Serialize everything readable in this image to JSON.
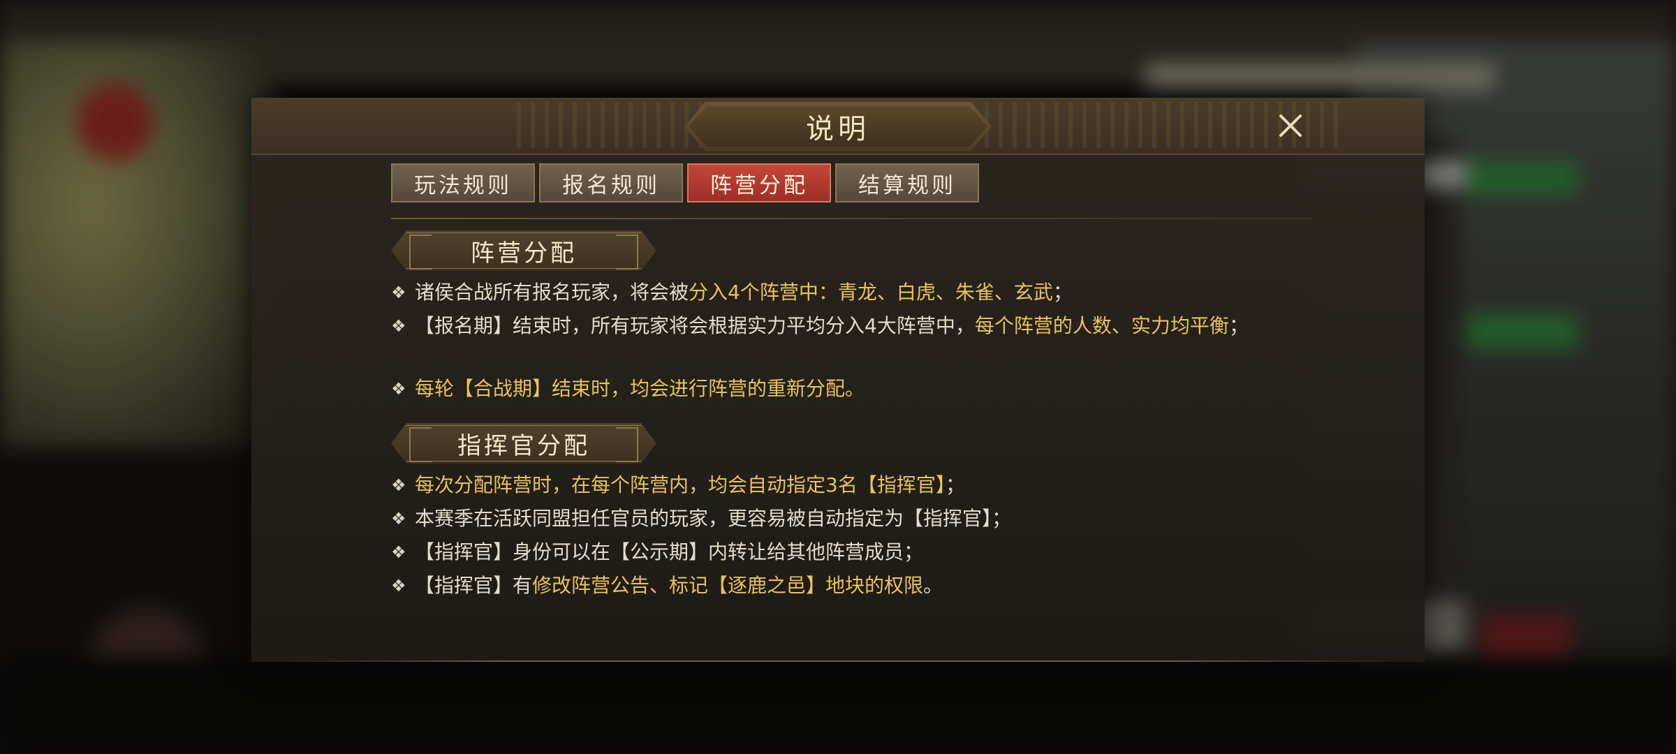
{
  "dialog": {
    "title": "说明",
    "close_icon": "close-x-icon"
  },
  "tabs": [
    {
      "label": "玩法规则",
      "active": false
    },
    {
      "label": "报名规则",
      "active": false
    },
    {
      "label": "阵营分配",
      "active": true
    },
    {
      "label": "结算规则",
      "active": false
    }
  ],
  "sections": [
    {
      "heading": "阵营分配",
      "items": [
        {
          "parts": [
            {
              "text": "诸侯合战所有报名玩家，将会被",
              "hl": false
            },
            {
              "text": "分入4个阵营中：青龙、白虎、朱雀、玄武",
              "hl": true
            },
            {
              "text": "；",
              "hl": false
            }
          ]
        },
        {
          "parts": [
            {
              "text": "【报名期】结束时，所有玩家将会根据实力平均分入4大阵营中，",
              "hl": false
            },
            {
              "text": "每个阵营的人数、实力均平衡",
              "hl": true
            },
            {
              "text": "；",
              "hl": false
            }
          ]
        },
        {
          "parts": [
            {
              "text": "每轮【合战期】结束时，均会进行阵营的重新分配。",
              "hl": true
            }
          ]
        }
      ]
    },
    {
      "heading": "指挥官分配",
      "items": [
        {
          "parts": [
            {
              "text": "每次分配阵营时，在每个阵营内，均会自动指定3名【指挥官】",
              "hl": true
            },
            {
              "text": "；",
              "hl": false
            }
          ]
        },
        {
          "parts": [
            {
              "text": "本赛季在活跃同盟担任官员的玩家，更容易被自动指定为【指挥官】；",
              "hl": false
            }
          ]
        },
        {
          "parts": [
            {
              "text": "【指挥官】身份可以在【公示期】内转让给其他阵营成员；",
              "hl": false
            }
          ]
        },
        {
          "parts": [
            {
              "text": "【指挥官】有",
              "hl": false
            },
            {
              "text": "修改阵营公告、标记【逐鹿之邑】地块的权限",
              "hl": true
            },
            {
              "text": "。",
              "hl": false
            }
          ]
        }
      ]
    }
  ],
  "colors": {
    "highlight": "#e8c35e",
    "body_text": "#e3dccd",
    "active_tab": "#b53c30",
    "title_text": "#f4e6c4"
  }
}
